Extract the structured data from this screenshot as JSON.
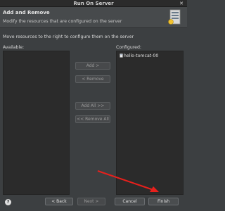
{
  "window": {
    "title": "Run On Server",
    "close_glyph": "✕"
  },
  "header": {
    "title": "Add and Remove",
    "description": "Modify the resources that are configured on the server"
  },
  "instruction": "Move resources to the right to configure them on the server",
  "available": {
    "label": "Available:",
    "items": []
  },
  "configured": {
    "label": "Configured:",
    "items": [
      {
        "label": "hello-tomcat-00"
      }
    ]
  },
  "buttons": {
    "add": "Add >",
    "remove": "< Remove",
    "add_all": "Add All >>",
    "remove_all": "<< Remove All",
    "back": "< Back",
    "next": "Next >",
    "cancel": "Cancel",
    "finish": "Finish"
  },
  "help_glyph": "?",
  "colors": {
    "annotation_arrow": "#e8201c",
    "accent": "#3c3f41"
  }
}
